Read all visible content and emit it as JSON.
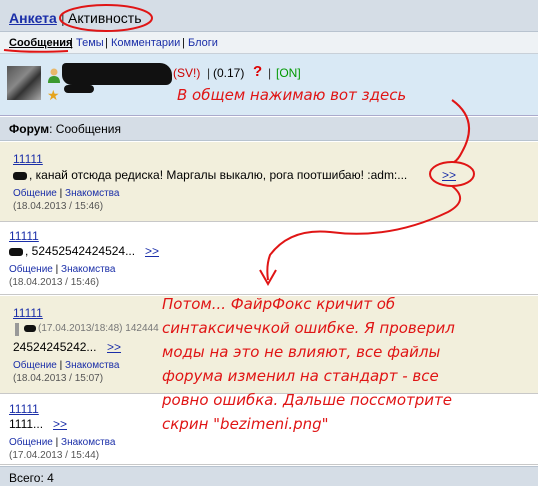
{
  "topbar": {
    "tab_profile": "Анкета",
    "separator": "|",
    "tab_activity": "Активность"
  },
  "subnav": {
    "messages": "Сообщения",
    "topics": "Темы",
    "comments": "Комментарии",
    "blogs": "Блоги",
    "sep": "|"
  },
  "profile": {
    "status_sv": "(SV!)",
    "separator": "|",
    "rating": "(0.17)",
    "question": "?",
    "online": "[ON]"
  },
  "annotations": {
    "note1": "В общем нажимаю вот здесь",
    "note2_lines": [
      "Потом... ФайрФокс кричит об",
      "синтаксичечкой ошибке. Я проверил",
      "моды на это не влияют, все файлы",
      "форума изменил на стандарт - все",
      "ровно ошибка. Дальше поссмотрите",
      "скрин \"bezimeni.png\""
    ]
  },
  "forum": {
    "label_bold": "Форум",
    "label_rest": ": Сообщения"
  },
  "posts": [
    {
      "author": "11111",
      "text": ", канай отсюда редиска! Маргалы выкалю, рога поотшибаю! :adm:...",
      "more": ">>",
      "link1": "Общение",
      "sep": "|",
      "link2": "Знакомства",
      "date": "(18.04.2013 / 15:46)"
    },
    {
      "author": "11111",
      "text": ", 52452542424524...",
      "more": ">>",
      "link1": "Общение",
      "sep": "|",
      "link2": "Знакомства",
      "date": "(18.04.2013 / 15:46)"
    },
    {
      "author": "11111",
      "quote": "(17.04.2013/18:48) 142444",
      "text": "24524245242...",
      "more": ">>",
      "link1": "Общение",
      "sep": "|",
      "link2": "Знакомства",
      "date": "(18.04.2013 / 15:07)"
    },
    {
      "author": "11111",
      "text": "1111...",
      "more": ">>",
      "link1": "Общение",
      "sep": "|",
      "link2": "Знакомства",
      "date": "(17.04.2013 / 15:44)"
    }
  ],
  "footer": {
    "total": "Всего: 4"
  },
  "colors": {
    "annotation_red": "#e01515",
    "link_blue": "#1a2ea8",
    "online_green": "#009900"
  }
}
